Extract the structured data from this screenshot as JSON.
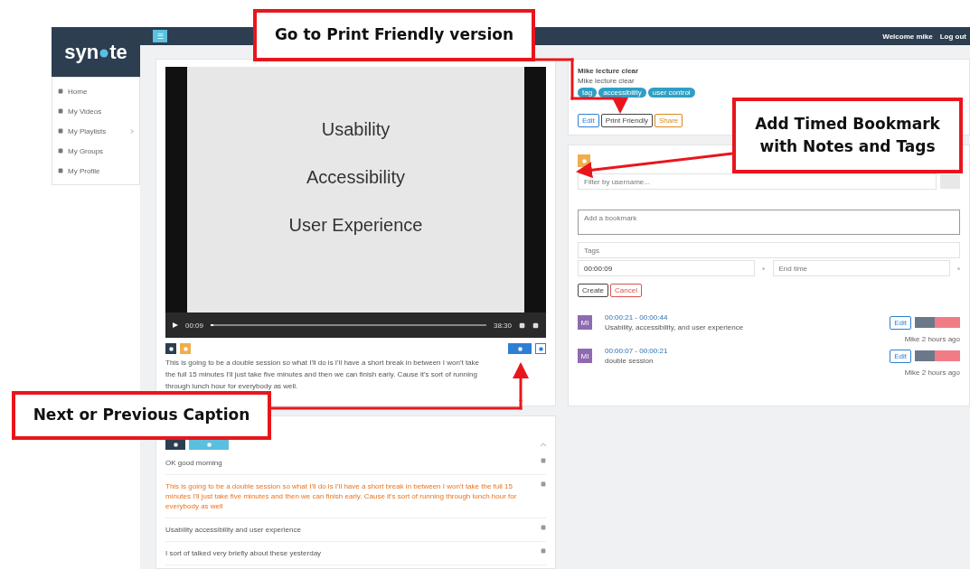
{
  "logo": {
    "before": "syn",
    "after": "te"
  },
  "topbar": {
    "menu_button": "☰",
    "welcome": "Welcome mike",
    "logout": "Log out"
  },
  "sidebar": {
    "items": [
      {
        "label": "Home",
        "expandable": false
      },
      {
        "label": "My Videos",
        "expandable": false
      },
      {
        "label": "My Playlists",
        "expandable": true
      },
      {
        "label": "My Groups",
        "expandable": false
      },
      {
        "label": "My Profile",
        "expandable": false
      }
    ]
  },
  "video": {
    "slides": [
      "Usability",
      "Accessibility",
      "User Experience"
    ],
    "current_time": "00:09",
    "duration": "38:30",
    "level": 0.01
  },
  "transcript": "This is going to be a double session so what I'll do is I'll have a short break in between I won't take the full 15 minutes I'll just take five minutes and then we can finish early. Cause it's sort of running through lunch hour for everybody as well.",
  "captions": [
    {
      "text": "OK good morning",
      "selected": false
    },
    {
      "text": "This is going to be a double session so what I'll do is I'll have a short break in between I won't take the full 15 minutes I'll just take five minutes and then we can finish early. Cause it's sort of running through lunch hour for everybody as well",
      "selected": true
    },
    {
      "text": "Usability accessibility and user experience",
      "selected": false
    },
    {
      "text": "I sort of talked very briefly about these yesterday",
      "selected": false
    }
  ],
  "details": {
    "title": "Mike lecture clear",
    "subtitle": "Mike lecture clear",
    "tags": [
      "tag",
      "accessibility",
      "user control"
    ],
    "buttons": [
      "Edit",
      "Print Friendly",
      "Share"
    ]
  },
  "bookmarks": {
    "filter_placeholder": "Filter by username...",
    "note_placeholder": "Add a bookmark",
    "tags_placeholder": "Tags",
    "start_time": "00:00:09",
    "end_placeholder": "End time",
    "buttons": [
      "Create",
      "Cancel"
    ],
    "items": [
      {
        "avatar": "MI",
        "time": "00:00:21 - 00:00:44",
        "text": "Usability, accessibility, and user experience",
        "edit": "Edit",
        "meta": "Mike  2 hours ago"
      },
      {
        "avatar": "MI",
        "time": "00:00:07 - 00:00:21",
        "text": "double session",
        "edit": "Edit",
        "meta": "Mike  2 hours ago"
      }
    ]
  },
  "annotations": [
    {
      "text": "Go to Print Friendly version"
    },
    {
      "text": "Add Timed Bookmark with Notes and Tags"
    },
    {
      "text": "Next or Previous Caption"
    }
  ]
}
